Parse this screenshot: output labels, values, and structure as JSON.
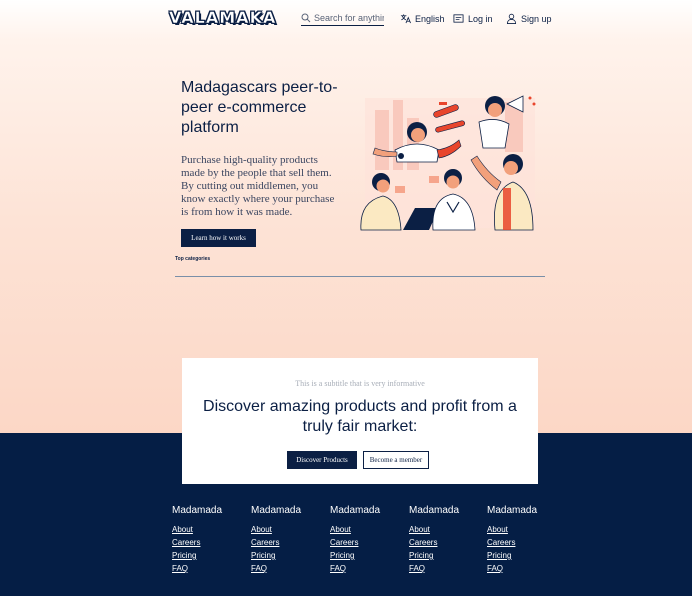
{
  "header": {
    "logo": "VALAMAKA",
    "search_placeholder": "Search for anything",
    "language": "English",
    "login": "Log in",
    "signup": "Sign up"
  },
  "hero": {
    "title": "Madagascars peer-to-peer e-commerce platform",
    "description": "Purchase high-quality products made by the people that sell them. By cutting out middlemen, you know exactly where your purchase is from how it was made.",
    "button": "Learn how it works",
    "top_categories": "Top categories"
  },
  "card": {
    "subtitle": "This is a subtitle that is very informative",
    "title": "Discover amazing products and profit from a truly fair market:",
    "primary_button": "Discover Products",
    "secondary_button": "Become a member"
  },
  "footer": {
    "columns": [
      {
        "title": "Madamada",
        "links": [
          "About",
          "Careers",
          "Pricing",
          "FAQ"
        ]
      },
      {
        "title": "Madamada",
        "links": [
          "About",
          "Careers",
          "Pricing",
          "FAQ"
        ]
      },
      {
        "title": "Madamada",
        "links": [
          "About",
          "Careers",
          "Pricing",
          "FAQ"
        ]
      },
      {
        "title": "Madamada",
        "links": [
          "About",
          "Careers",
          "Pricing",
          "FAQ"
        ]
      },
      {
        "title": "Madamada",
        "links": [
          "About",
          "Careers",
          "Pricing",
          "FAQ"
        ]
      }
    ]
  },
  "colors": {
    "navy": "#0b1f44",
    "footer": "#051e45",
    "accent": "#e8452c"
  }
}
